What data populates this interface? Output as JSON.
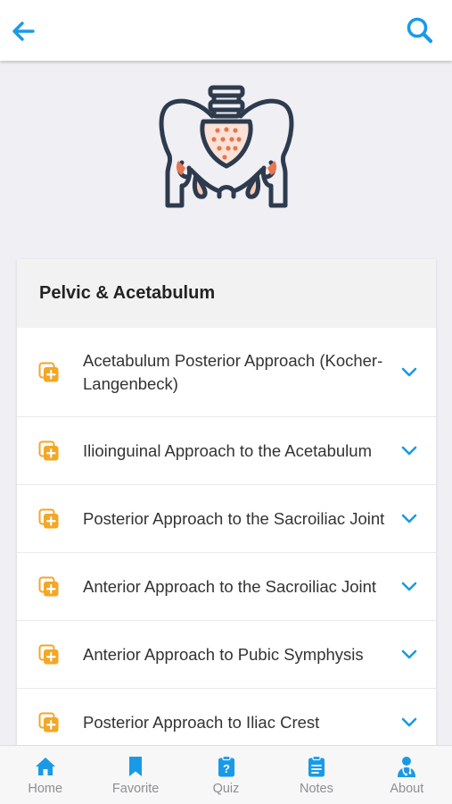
{
  "header": {
    "back_icon": "arrow-left-icon",
    "search_icon": "search-icon",
    "accent_color": "#1a9ae6"
  },
  "hero": {
    "icon": "pelvis-illustration"
  },
  "section": {
    "title": "Pelvic & Acetabulum",
    "items": [
      {
        "label": "Acetabulum Posterior Approach (Kocher-Langenbeck)",
        "icon": "add-to-list-icon"
      },
      {
        "label": "Ilioinguinal Approach to the Acetabulum",
        "icon": "add-to-list-icon"
      },
      {
        "label": "Posterior Approach to the Sacroiliac Joint",
        "icon": "add-to-list-icon"
      },
      {
        "label": "Anterior Approach to the Sacroiliac Joint",
        "icon": "add-to-list-icon"
      },
      {
        "label": "Anterior Approach to Pubic Symphysis",
        "icon": "add-to-list-icon"
      },
      {
        "label": "Posterior Approach to Iliac Crest",
        "icon": "add-to-list-icon"
      }
    ]
  },
  "bottom_nav": [
    {
      "label": "Home",
      "icon": "home-icon"
    },
    {
      "label": "Favorite",
      "icon": "bookmark-icon"
    },
    {
      "label": "Quiz",
      "icon": "quiz-clipboard-icon"
    },
    {
      "label": "Notes",
      "icon": "notes-clipboard-icon"
    },
    {
      "label": "About",
      "icon": "doctor-icon"
    }
  ]
}
